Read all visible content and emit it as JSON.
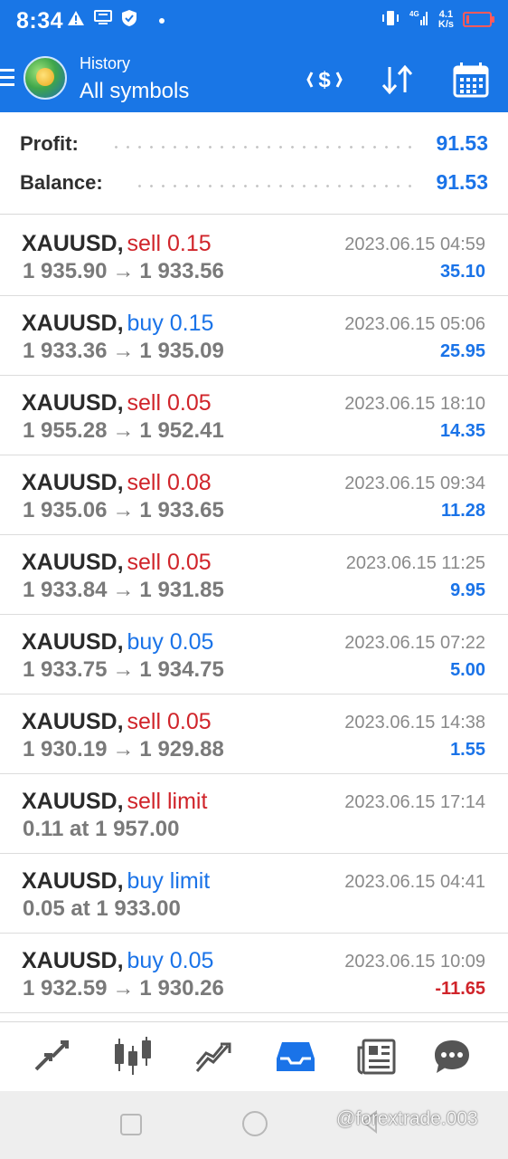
{
  "status_bar": {
    "time": "8:34",
    "network_speed_top": "4.1",
    "network_speed_bottom": "K/s",
    "signal_label": "4G",
    "icons": [
      "warning-icon",
      "message-icon",
      "shield-icon",
      "vibrate-icon",
      "signal-icon",
      "battery-icon"
    ]
  },
  "header": {
    "subtitle": "History",
    "title": "All symbols",
    "actions": [
      "exchange-dollar-icon",
      "sort-icon",
      "calendar-icon"
    ]
  },
  "summary": {
    "profit_label": "Profit:",
    "profit_value": "91.53",
    "balance_label": "Balance:",
    "balance_value": "91.53"
  },
  "deals": [
    {
      "symbol": "XAUUSD,",
      "side": "sell 0.15",
      "side_type": "sell",
      "open": "1 935.90",
      "arrow": "→",
      "close": "1 933.56",
      "time": "2023.06.15 04:59",
      "profit": "35.10",
      "profit_type": "pos"
    },
    {
      "symbol": "XAUUSD,",
      "side": "buy 0.15",
      "side_type": "buy",
      "open": "1 933.36",
      "arrow": "→",
      "close": "1 935.09",
      "time": "2023.06.15 05:06",
      "profit": "25.95",
      "profit_type": "pos"
    },
    {
      "symbol": "XAUUSD,",
      "side": "sell 0.05",
      "side_type": "sell",
      "open": "1 955.28",
      "arrow": "→",
      "close": "1 952.41",
      "time": "2023.06.15 18:10",
      "profit": "14.35",
      "profit_type": "pos"
    },
    {
      "symbol": "XAUUSD,",
      "side": "sell 0.08",
      "side_type": "sell",
      "open": "1 935.06",
      "arrow": "→",
      "close": "1 933.65",
      "time": "2023.06.15 09:34",
      "profit": "11.28",
      "profit_type": "pos"
    },
    {
      "symbol": "XAUUSD,",
      "side": "sell 0.05",
      "side_type": "sell",
      "open": "1 933.84",
      "arrow": "→",
      "close": "1 931.85",
      "time": "2023.06.15 11:25",
      "profit": "9.95",
      "profit_type": "pos"
    },
    {
      "symbol": "XAUUSD,",
      "side": "buy 0.05",
      "side_type": "buy",
      "open": "1 933.75",
      "arrow": "→",
      "close": "1 934.75",
      "time": "2023.06.15 07:22",
      "profit": "5.00",
      "profit_type": "pos"
    },
    {
      "symbol": "XAUUSD,",
      "side": "sell 0.05",
      "side_type": "sell",
      "open": "1 930.19",
      "arrow": "→",
      "close": "1 929.88",
      "time": "2023.06.15 14:38",
      "profit": "1.55",
      "profit_type": "pos"
    },
    {
      "symbol": "XAUUSD,",
      "side": "sell limit",
      "side_type": "sell",
      "open": "0.11 at 1 957.00",
      "arrow": "",
      "close": "",
      "time": "2023.06.15 17:14",
      "profit": "",
      "profit_type": "pos"
    },
    {
      "symbol": "XAUUSD,",
      "side": "buy limit",
      "side_type": "buy",
      "open": "0.05 at 1 933.00",
      "arrow": "",
      "close": "",
      "time": "2023.06.15 04:41",
      "profit": "",
      "profit_type": "pos"
    },
    {
      "symbol": "XAUUSD,",
      "side": "buy 0.05",
      "side_type": "buy",
      "open": "1 932.59",
      "arrow": "→",
      "close": "1 930.26",
      "time": "2023.06.15 10:09",
      "profit": "-11.65",
      "profit_type": "neg"
    }
  ],
  "bottom_nav": {
    "items": [
      "quotes-icon",
      "chart-icon",
      "trade-icon",
      "history-icon",
      "news-icon",
      "chat-icon"
    ],
    "active": "history-icon",
    "active_color": "#1a73e8",
    "inactive_color": "#555555"
  },
  "watermark": "@forextrade.003",
  "colors": {
    "header_bg": "#1976e6",
    "sell": "#d0242a",
    "buy": "#1a73e8",
    "profit_pos": "#1a73e8",
    "profit_neg": "#d0242a"
  }
}
